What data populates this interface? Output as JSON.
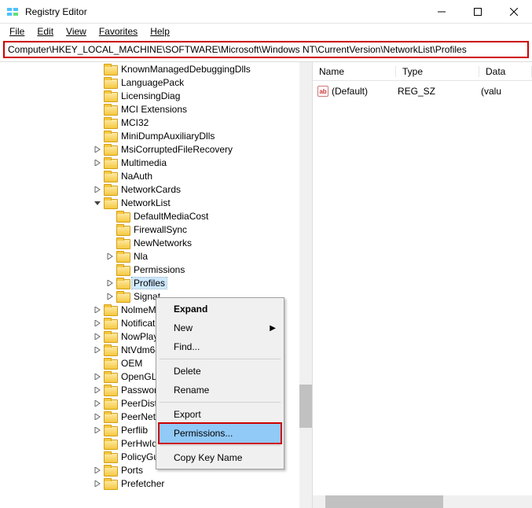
{
  "window": {
    "title": "Registry Editor"
  },
  "menus": {
    "file": "File",
    "edit": "Edit",
    "view": "View",
    "favorites": "Favorites",
    "help": "Help"
  },
  "address": "Computer\\HKEY_LOCAL_MACHINE\\SOFTWARE\\Microsoft\\Windows NT\\CurrentVersion\\NetworkList\\Profiles",
  "tree": [
    {
      "lvl": 1,
      "exp": "",
      "label": "KnownManagedDebuggingDlls"
    },
    {
      "lvl": 1,
      "exp": "",
      "label": "LanguagePack"
    },
    {
      "lvl": 1,
      "exp": "",
      "label": "LicensingDiag"
    },
    {
      "lvl": 1,
      "exp": "",
      "label": "MCI Extensions"
    },
    {
      "lvl": 1,
      "exp": "",
      "label": "MCI32"
    },
    {
      "lvl": 1,
      "exp": "",
      "label": "MiniDumpAuxiliaryDlls"
    },
    {
      "lvl": 1,
      "exp": ">",
      "label": "MsiCorruptedFileRecovery"
    },
    {
      "lvl": 1,
      "exp": ">",
      "label": "Multimedia"
    },
    {
      "lvl": 1,
      "exp": "",
      "label": "NaAuth"
    },
    {
      "lvl": 1,
      "exp": ">",
      "label": "NetworkCards"
    },
    {
      "lvl": 1,
      "exp": "v",
      "label": "NetworkList"
    },
    {
      "lvl": 2,
      "exp": "",
      "label": "DefaultMediaCost"
    },
    {
      "lvl": 2,
      "exp": "",
      "label": "FirewallSync"
    },
    {
      "lvl": 2,
      "exp": "",
      "label": "NewNetworks"
    },
    {
      "lvl": 2,
      "exp": ">",
      "label": "Nla"
    },
    {
      "lvl": 2,
      "exp": "",
      "label": "Permissions"
    },
    {
      "lvl": 2,
      "exp": ">",
      "label": "Profiles",
      "selected": true
    },
    {
      "lvl": 2,
      "exp": ">",
      "label": "Signat"
    },
    {
      "lvl": 1,
      "exp": ">",
      "label": "NolmeM"
    },
    {
      "lvl": 1,
      "exp": ">",
      "label": "Notificat"
    },
    {
      "lvl": 1,
      "exp": ">",
      "label": "NowPlay"
    },
    {
      "lvl": 1,
      "exp": ">",
      "label": "NtVdm64"
    },
    {
      "lvl": 1,
      "exp": "",
      "label": "OEM"
    },
    {
      "lvl": 1,
      "exp": ">",
      "label": "OpenGLD"
    },
    {
      "lvl": 1,
      "exp": ">",
      "label": "Password"
    },
    {
      "lvl": 1,
      "exp": ">",
      "label": "PeerDist"
    },
    {
      "lvl": 1,
      "exp": ">",
      "label": "PeerNet"
    },
    {
      "lvl": 1,
      "exp": ">",
      "label": "Perflib"
    },
    {
      "lvl": 1,
      "exp": "",
      "label": "PerHwIdStorage"
    },
    {
      "lvl": 1,
      "exp": "",
      "label": "PolicyGuid"
    },
    {
      "lvl": 1,
      "exp": ">",
      "label": "Ports"
    },
    {
      "lvl": 1,
      "exp": ">",
      "label": "Prefetcher"
    }
  ],
  "columns": {
    "name": "Name",
    "type": "Type",
    "data": "Data"
  },
  "values": [
    {
      "name": "(Default)",
      "type": "REG_SZ",
      "data": "(valu"
    }
  ],
  "context_menu": {
    "expand": "Expand",
    "new": "New",
    "find": "Find...",
    "delete": "Delete",
    "rename": "Rename",
    "export": "Export",
    "permissions": "Permissions...",
    "copy_key_name": "Copy Key Name"
  }
}
